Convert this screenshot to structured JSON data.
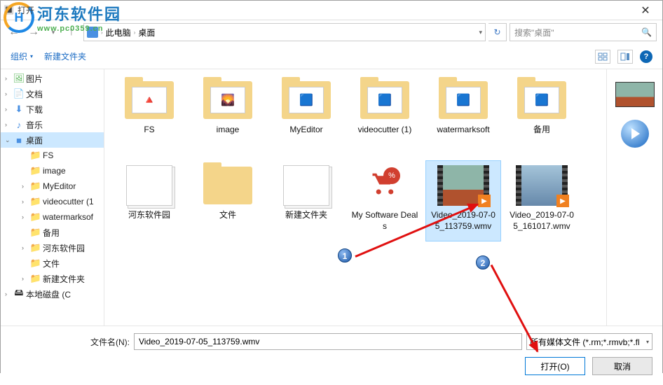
{
  "window": {
    "title": "打开"
  },
  "watermark": {
    "text": "河东软件园",
    "url": "www.pc0359.cn"
  },
  "nav": {
    "path1": "此电脑",
    "path2": "桌面",
    "search_placeholder": "搜索\"桌面\""
  },
  "toolbar": {
    "organize": "组织",
    "new_folder": "新建文件夹"
  },
  "sidebar": {
    "items": [
      {
        "icon": "🖼",
        "label": "图片",
        "cls": "green-i",
        "chev": "›"
      },
      {
        "icon": "📄",
        "label": "文档",
        "cls": "folder-i",
        "chev": "›"
      },
      {
        "icon": "⬇",
        "label": "下载",
        "cls": "blue-i",
        "chev": "›"
      },
      {
        "icon": "♪",
        "label": "音乐",
        "cls": "blue-i",
        "chev": "›"
      },
      {
        "icon": "■",
        "label": "桌面",
        "cls": "blue-i",
        "sel": true,
        "chev": "⌄"
      },
      {
        "icon": "📁",
        "label": "FS",
        "cls": "folder-i",
        "sub": true
      },
      {
        "icon": "📁",
        "label": "image",
        "cls": "folder-i",
        "sub": true
      },
      {
        "icon": "📁",
        "label": "MyEditor",
        "cls": "folder-i",
        "sub": true,
        "chev": "›"
      },
      {
        "icon": "📁",
        "label": "videocutter (1",
        "cls": "folder-i",
        "sub": true,
        "chev": "›"
      },
      {
        "icon": "📁",
        "label": "watermarksof",
        "cls": "folder-i",
        "sub": true,
        "chev": "›"
      },
      {
        "icon": "📁",
        "label": "备用",
        "cls": "folder-i",
        "sub": true
      },
      {
        "icon": "📁",
        "label": "河东软件园",
        "cls": "folder-i",
        "sub": true,
        "chev": "›"
      },
      {
        "icon": "📁",
        "label": "文件",
        "cls": "folder-i",
        "sub": true
      },
      {
        "icon": "📁",
        "label": "新建文件夹",
        "cls": "folder-i",
        "sub": true,
        "chev": "›"
      },
      {
        "icon": "🖴",
        "label": "本地磁盘 (C",
        "cls": "",
        "chev": "›"
      }
    ]
  },
  "files": [
    {
      "label": "FS",
      "type": "folder-thumb",
      "thumb": "logo"
    },
    {
      "label": "image",
      "type": "folder-thumb",
      "thumb": "photo"
    },
    {
      "label": "MyEditor",
      "type": "folder-thumb",
      "thumb": "app"
    },
    {
      "label": "videocutter (1)",
      "type": "folder-thumb",
      "thumb": "icon"
    },
    {
      "label": "watermarksoft",
      "type": "folder-thumb",
      "thumb": "icon2"
    },
    {
      "label": "备用",
      "type": "folder-thumb",
      "thumb": "img"
    },
    {
      "label": "河东软件园",
      "type": "paper"
    },
    {
      "label": "文件",
      "type": "folder-empty"
    },
    {
      "label": "新建文件夹",
      "type": "paper"
    },
    {
      "label": "My Software Deals",
      "type": "cart"
    },
    {
      "label": "Video_2019-07-05_113759.wmv",
      "type": "video1",
      "sel": true
    },
    {
      "label": "Video_2019-07-05_161017.wmv",
      "type": "video2"
    }
  ],
  "badges": {
    "b1": "1",
    "b2": "2"
  },
  "bottom": {
    "filename_label": "文件名(N):",
    "filename_value": "Video_2019-07-05_113759.wmv",
    "filter": "所有媒体文件 (*.rm;*.rmvb;*.fl",
    "open": "打开(O)",
    "cancel": "取消"
  }
}
